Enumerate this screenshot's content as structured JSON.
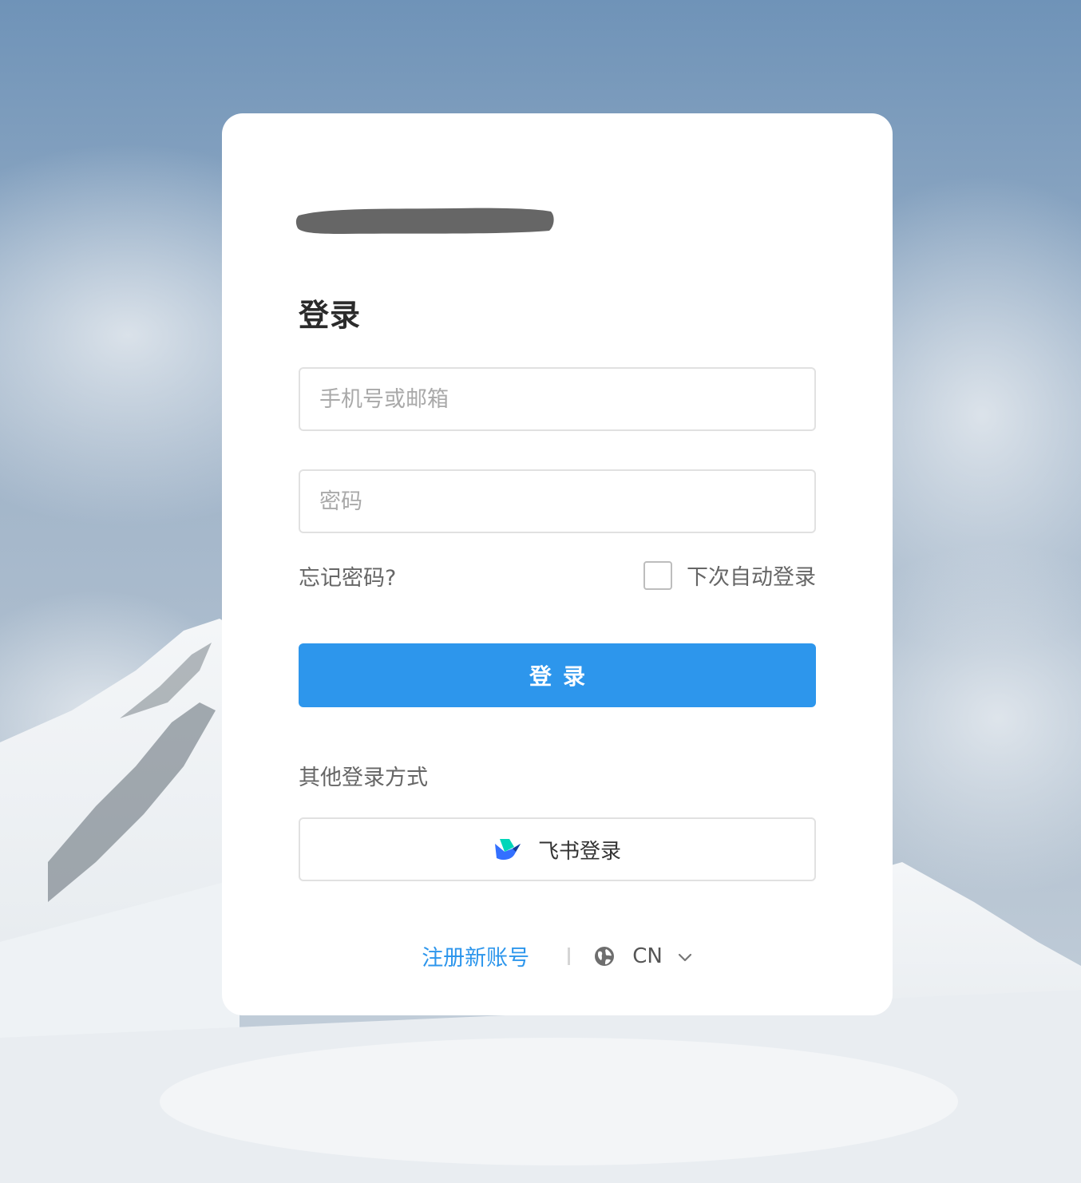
{
  "brand": {
    "logo": "redacted-brand-logo"
  },
  "login": {
    "title": "登录",
    "account_placeholder": "手机号或邮箱",
    "account_value": "",
    "password_placeholder": "密码",
    "password_value": "",
    "forgot_label": "忘记密码?",
    "remember_label": "下次自动登录",
    "remember_checked": false,
    "submit_label": "登录"
  },
  "other": {
    "title": "其他登录方式",
    "feishu_label": "飞书登录",
    "feishu_icon": "feishu-logo-icon"
  },
  "footer": {
    "register_label": "注册新账号",
    "language_label": "CN",
    "globe_icon": "globe-icon",
    "chevron_icon": "chevron-down-icon"
  },
  "colors": {
    "primary": "#2d96ec",
    "card": "#ffffff",
    "text_muted": "#666666"
  }
}
